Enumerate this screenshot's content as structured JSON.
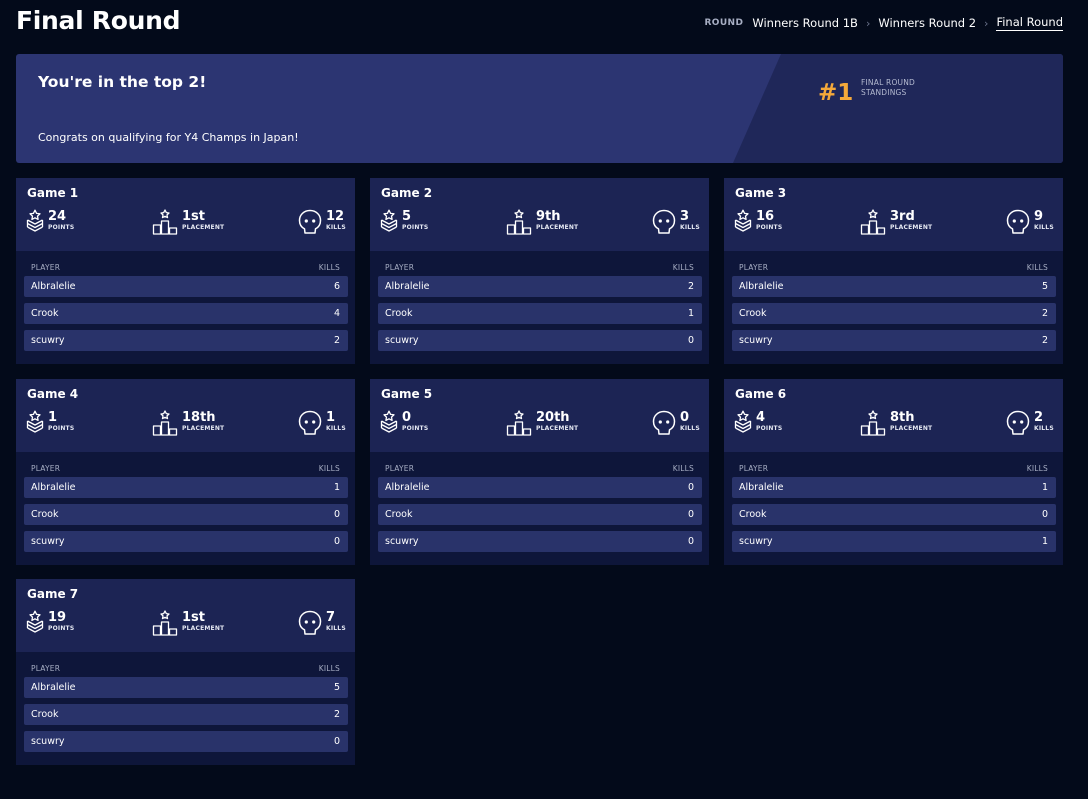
{
  "header": {
    "title": "Final Round",
    "breadcrumb_label": "ROUND",
    "breadcrumb": [
      "Winners Round 1B",
      "Winners Round 2",
      "Final Round"
    ],
    "separator": ">"
  },
  "banner": {
    "heading": "You're in the top 2!",
    "subtext": "Congrats on qualifying for Y4 Champs in Japan!",
    "rank": "#1",
    "rank_label": "FINAL ROUND STANDINGS",
    "rank_color": "#f5a93a"
  },
  "labels": {
    "points": "POINTS",
    "placement": "PLACEMENT",
    "kills": "KILLS",
    "player_col": "PLAYER",
    "kills_col": "KILLS"
  },
  "icons": {
    "points": "chevron-star-icon",
    "placement": "podium-icon",
    "kills": "skull-icon"
  },
  "games": [
    {
      "title": "Game 1",
      "points": "24",
      "placement": "1st",
      "kills": "12",
      "players": [
        {
          "name": "Albralelie",
          "kills": "6"
        },
        {
          "name": "Crook",
          "kills": "4"
        },
        {
          "name": "scuwry",
          "kills": "2"
        }
      ]
    },
    {
      "title": "Game 2",
      "points": "5",
      "placement": "9th",
      "kills": "3",
      "players": [
        {
          "name": "Albralelie",
          "kills": "2"
        },
        {
          "name": "Crook",
          "kills": "1"
        },
        {
          "name": "scuwry",
          "kills": "0"
        }
      ]
    },
    {
      "title": "Game 3",
      "points": "16",
      "placement": "3rd",
      "kills": "9",
      "players": [
        {
          "name": "Albralelie",
          "kills": "5"
        },
        {
          "name": "Crook",
          "kills": "2"
        },
        {
          "name": "scuwry",
          "kills": "2"
        }
      ]
    },
    {
      "title": "Game 4",
      "points": "1",
      "placement": "18th",
      "kills": "1",
      "players": [
        {
          "name": "Albralelie",
          "kills": "1"
        },
        {
          "name": "Crook",
          "kills": "0"
        },
        {
          "name": "scuwry",
          "kills": "0"
        }
      ]
    },
    {
      "title": "Game 5",
      "points": "0",
      "placement": "20th",
      "kills": "0",
      "players": [
        {
          "name": "Albralelie",
          "kills": "0"
        },
        {
          "name": "Crook",
          "kills": "0"
        },
        {
          "name": "scuwry",
          "kills": "0"
        }
      ]
    },
    {
      "title": "Game 6",
      "points": "4",
      "placement": "8th",
      "kills": "2",
      "players": [
        {
          "name": "Albralelie",
          "kills": "1"
        },
        {
          "name": "Crook",
          "kills": "0"
        },
        {
          "name": "scuwry",
          "kills": "1"
        }
      ]
    },
    {
      "title": "Game 7",
      "points": "19",
      "placement": "1st",
      "kills": "7",
      "players": [
        {
          "name": "Albralelie",
          "kills": "5"
        },
        {
          "name": "Crook",
          "kills": "2"
        },
        {
          "name": "scuwry",
          "kills": "0"
        }
      ]
    }
  ]
}
